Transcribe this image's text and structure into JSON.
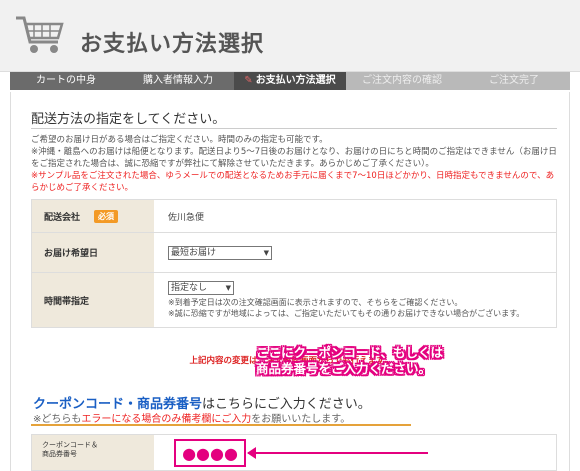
{
  "header": {
    "title": "お支払い方法選択"
  },
  "steps": [
    {
      "label": "カートの中身"
    },
    {
      "label": "購入者情報入力"
    },
    {
      "label": "お支払い方法選択"
    },
    {
      "label": "ご注文内容の確認"
    },
    {
      "label": "ご注文完了"
    }
  ],
  "section": {
    "title": "配送方法の指定をしてください。",
    "note1": "ご希望のお届け日がある場合はご指定ください。時間のみの指定も可能です。",
    "note2": "※沖縄・離島へのお届けは船便となります。配送日より5～7日後のお届けとなり、お届けの日にちと時間のご指定はできません（お届け日をご指定された場合は、誠に恐縮ですが弊社にて解除させていただきます。あらかじめご了承ください）。",
    "note3": "※サンプル品をご注文された場合、ゆうメールでの配送となるためお手元に届くまで7～10日ほどかかり、日時指定もできませんので、あらかじめご了承ください。"
  },
  "table": {
    "carrier_label": "配送会社",
    "carrier_badge": "必須",
    "carrier_value": "佐川急便",
    "date_label": "お届け希望日",
    "date_value": "最短お届け",
    "time_label": "時間帯指定",
    "time_value": "指定なし",
    "time_note1": "※到着予定日は次の注文確認画面に表示されますので、そちらをご確認ください。",
    "time_note2": "※誠に恐縮ですが地域によっては、ご指定いただいてもその通りお届けできない場合がございます。"
  },
  "notice": "上記内容の変更は、注文確認画面からでも行えます。",
  "coupon": {
    "title_blue": "クーポンコード・商品券番号",
    "title_rest": "はこちらにご入力ください。",
    "sub_pre": "※どちらも",
    "sub_red": "エラーになる場合のみ備考欄にご入力",
    "sub_post": "をお願いいたします。",
    "label": "クーポンコード＆\n商品券番号",
    "dots": "●●●●",
    "callout_line1": "ここにクーポンコード、もしくは",
    "callout_line2": "商品券番号をご入力ください。"
  },
  "colors": {
    "accent": "#e4007f",
    "coupon_blue": "#1a5fc4",
    "error_red": "#e22222"
  }
}
